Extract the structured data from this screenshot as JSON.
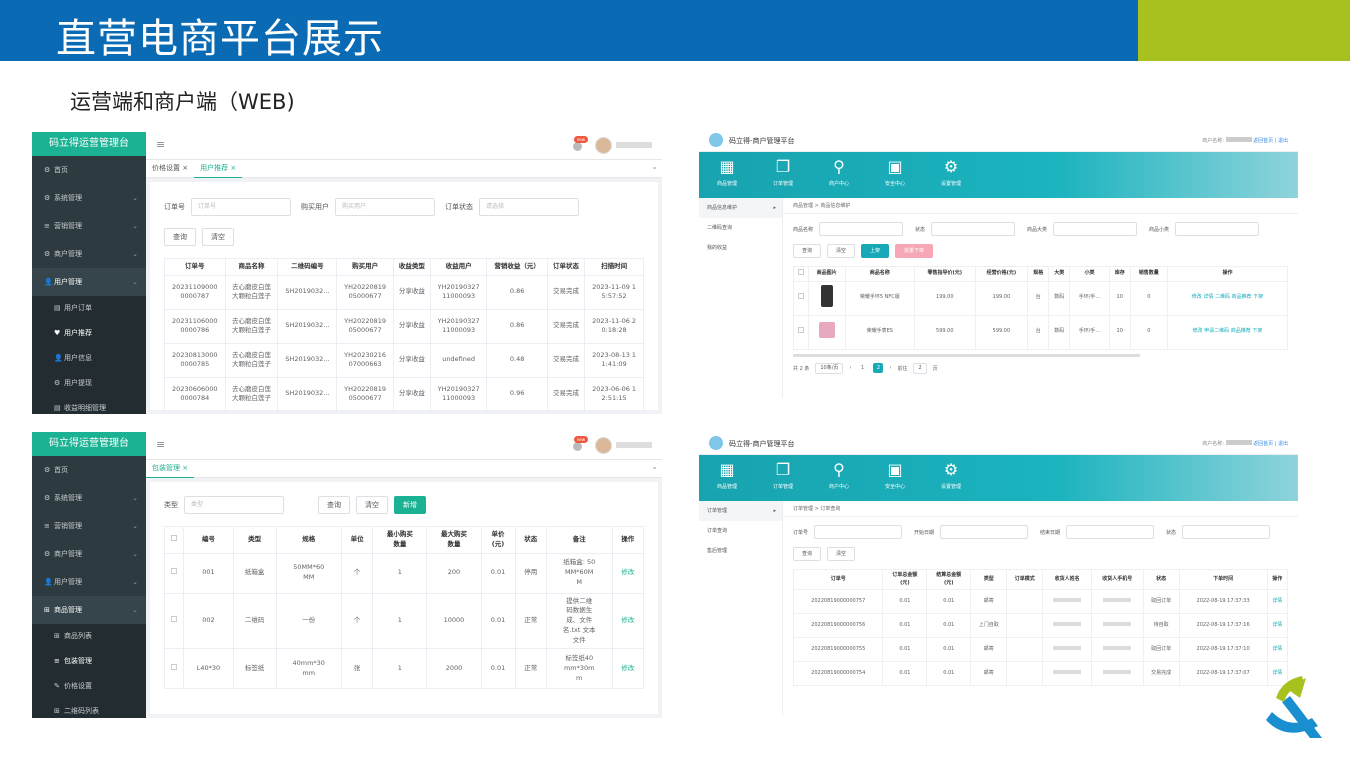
{
  "header": {
    "title": "直营电商平台展示",
    "subtitle": "运营端和商户端（WEB)"
  },
  "colors": {
    "banner_blue": "#0a6bb4",
    "banner_green": "#a8c11f",
    "admin_accent": "#1bb193",
    "merchant_accent": "#17a9b8"
  },
  "admin1": {
    "logo": "码立得运营管理台",
    "menu": [
      {
        "icon": "⚙",
        "label": "首页"
      },
      {
        "icon": "⚙",
        "label": "系统管理"
      },
      {
        "icon": "≡",
        "label": "营销管理"
      },
      {
        "icon": "⚙",
        "label": "商户管理"
      },
      {
        "icon": "👤",
        "label": "用户管理"
      },
      {
        "icon": "▤",
        "label": "用户订单"
      },
      {
        "icon": "♥",
        "label": "用户推荐"
      },
      {
        "icon": "👤",
        "label": "用户信息"
      },
      {
        "icon": "⚙",
        "label": "用户提现"
      },
      {
        "icon": "▤",
        "label": "收益明细管理"
      }
    ],
    "tabs": [
      "价格设置 ×",
      "用户推荐 ×"
    ],
    "badge": "new",
    "filters": {
      "order_no_label": "订单号",
      "order_no_ph": "订单号",
      "buyer_label": "购买用户",
      "buyer_ph": "购买用户",
      "status_label": "订单状态",
      "status_ph": "请选择"
    },
    "buttons": {
      "search": "查询",
      "clear": "清空"
    },
    "columns": [
      "订单号",
      "商品名称",
      "二维码编号",
      "购买用户",
      "收益类型",
      "收益用户",
      "营销收益（元）",
      "订单状态",
      "扫描时间"
    ],
    "rows": [
      [
        "20231109000\n0000787",
        "去心磨皮白莲\n大颗粒白莲子",
        "SH2019032...",
        "YH20220819\n05000677",
        "分享收益",
        "YH20190327\n11000093",
        "0.86",
        "交易完成",
        "2023-11-09 1\n5:57:52"
      ],
      [
        "20231106000\n0000786",
        "去心磨皮白莲\n大颗粒白莲子",
        "SH2019032...",
        "YH20220819\n05000677",
        "分享收益",
        "YH20190327\n11000093",
        "0.86",
        "交易完成",
        "2023-11-06 2\n0:18:28"
      ],
      [
        "20230813000\n0000785",
        "去心磨皮白莲\n大颗粒白莲子",
        "SH2019032...",
        "YH20230216\n07000663",
        "分享收益",
        "undefined",
        "0.48",
        "交易完成",
        "2023-08-13 1\n1:41:09"
      ],
      [
        "20230606000\n0000784",
        "去心磨皮白莲\n大颗粒白莲子",
        "SH2019032...",
        "YH20220819\n05000677",
        "分享收益",
        "YH20190327\n11000093",
        "0.96",
        "交易完成",
        "2023-06-06 1\n2:51:15"
      ]
    ]
  },
  "admin2": {
    "logo": "码立得运营管理台",
    "menu": [
      {
        "icon": "⚙",
        "label": "首页"
      },
      {
        "icon": "⚙",
        "label": "系统管理"
      },
      {
        "icon": "≡",
        "label": "营销管理"
      },
      {
        "icon": "⚙",
        "label": "商户管理"
      },
      {
        "icon": "👤",
        "label": "用户管理"
      },
      {
        "icon": "⊞",
        "label": "商品管理"
      },
      {
        "icon": "⊞",
        "label": "商品列表"
      },
      {
        "icon": "≡",
        "label": "包装管理"
      },
      {
        "icon": "✎",
        "label": "价格设置"
      },
      {
        "icon": "⊞",
        "label": "二维码列表"
      }
    ],
    "tabs": [
      "包装管理 ×"
    ],
    "badge": "new",
    "filters": {
      "type_label": "类型",
      "type_ph": "类型"
    },
    "buttons": {
      "search": "查询",
      "clear": "清空",
      "add": "新增"
    },
    "columns": [
      "",
      "编号",
      "类型",
      "规格",
      "单位",
      "最小购买\n数量",
      "最大购买\n数量",
      "单价\n(元)",
      "状态",
      "备注",
      "操作"
    ],
    "rows": [
      [
        "",
        "001",
        "纸箱盒",
        "50MM*60\nMM",
        "个",
        "1",
        "200",
        "0.01",
        "停用",
        "纸箱盒: 50\nMM*60M\nM",
        "修改"
      ],
      [
        "",
        "002",
        "二维码",
        "一份",
        "个",
        "1",
        "10000",
        "0.01",
        "正常",
        "提供二维\n码数据生\n成、文件\n名.txt 文本\n文件",
        "修改"
      ],
      [
        "",
        "L40*30",
        "标签纸",
        "40mm*30\nmm",
        "张",
        "1",
        "2000",
        "0.01",
        "正常",
        "标签纸40\nmm*30m\nm",
        "修改"
      ]
    ]
  },
  "merchant1": {
    "title": "码立得-商户管理平台",
    "top_right_prefix": "商户名称:",
    "top_right_links": "返回首页 | 退出",
    "nav": [
      {
        "icon": "▦",
        "label": "商品管理"
      },
      {
        "icon": "❐",
        "label": "订单管理"
      },
      {
        "icon": "⚲",
        "label": "商户中心"
      },
      {
        "icon": "▣",
        "label": "安全中心"
      },
      {
        "icon": "⚙",
        "label": "设置管理"
      }
    ],
    "side": [
      "商品信息维护",
      "二维码查询",
      "我的收益"
    ],
    "crumb": "商品管理 > 商品信息维护",
    "filters": {
      "name": "商品名称",
      "status": "状态",
      "cat1": "商品大类",
      "cat2": "商品小类"
    },
    "buttons": {
      "search": "查询",
      "clear": "清空",
      "up": "上架",
      "down": "批量下架"
    },
    "columns": [
      "",
      "商品图片",
      "商品名称",
      "零售指导价(元)",
      "经营价格(元)",
      "规格",
      "大类",
      "小类",
      "库存",
      "销售数量",
      "操作"
    ],
    "rows": [
      [
        "",
        "",
        "荣耀手环5 NFC版",
        "199.00",
        "199.00",
        "台",
        "数码",
        "手环/手...",
        "10",
        "0",
        "修改 详情 二维码 商品推荐 下架"
      ],
      [
        "",
        "",
        "荣耀手表ES",
        "599.00",
        "599.00",
        "台",
        "数码",
        "手环/手...",
        "10",
        "0",
        "修改 申请二维码 商品推荐 下架"
      ]
    ],
    "pager": {
      "total": "共 2 条",
      "size": "10条/页",
      "page1": "1",
      "page2": "2",
      "goto": "前往",
      "goto_val": "2",
      "page_unit": "页"
    }
  },
  "merchant2": {
    "title": "码立得-商户管理平台",
    "top_right_prefix": "商户名称:",
    "top_right_links": "返回首页 | 退出",
    "nav": [
      {
        "icon": "▦",
        "label": "商品管理"
      },
      {
        "icon": "❐",
        "label": "订单管理"
      },
      {
        "icon": "⚲",
        "label": "商户中心"
      },
      {
        "icon": "▣",
        "label": "安全中心"
      },
      {
        "icon": "⚙",
        "label": "设置管理"
      }
    ],
    "side": [
      "订单管理",
      "订单查询",
      "售后管理"
    ],
    "crumb": "订单管理 > 订单查询",
    "filters": {
      "order": "订单号",
      "start": "开始日期",
      "end": "结束日期",
      "status": "状态"
    },
    "buttons": {
      "search": "查询",
      "clear": "清空"
    },
    "columns": [
      "订单号",
      "订单总金额\n(元)",
      "结算总金额\n(元)",
      "类型",
      "订单模式",
      "收货人姓名",
      "收货人手机号",
      "状态",
      "下单时间",
      "操作"
    ],
    "rows": [
      [
        "20220819000000757",
        "0.01",
        "0.01",
        "邮寄",
        "",
        "",
        "",
        "取回订单",
        "2022-08-19 17:37:33",
        "详情"
      ],
      [
        "20220819000000756",
        "0.01",
        "0.01",
        "上门自取",
        "",
        "",
        "",
        "待自取",
        "2022-08-19 17:37:16",
        "详情"
      ],
      [
        "20220819000000755",
        "0.01",
        "0.01",
        "邮寄",
        "",
        "",
        "",
        "取回订单",
        "2022-08-19 17:37:10",
        "详情"
      ],
      [
        "20220819000000754",
        "0.01",
        "0.01",
        "邮寄",
        "",
        "",
        "",
        "交易完成",
        "2022-08-19 17:37:07",
        "详情"
      ]
    ]
  }
}
